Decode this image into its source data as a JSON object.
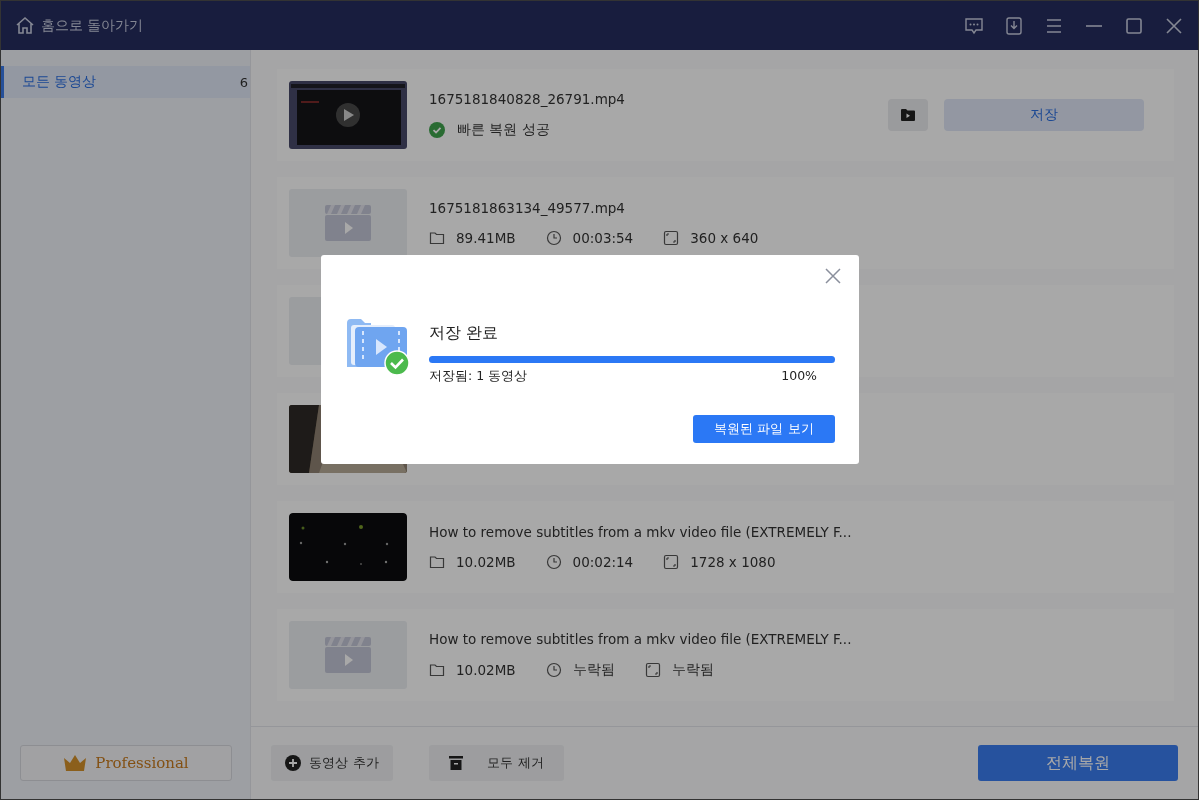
{
  "title_bar": {
    "back_label": "홈으로 돌아가기"
  },
  "sidebar": {
    "items": [
      {
        "label": "모든 동영상",
        "count": "6",
        "selected": true
      }
    ],
    "upgrade_label": "Professional"
  },
  "videos": [
    {
      "thumbnail": {
        "kind": "picture"
      },
      "name": "1675181840828_26791.mp4",
      "status": {
        "kind": "success",
        "text": "빠른 복원 성공"
      },
      "save_label": "저장"
    },
    {
      "thumbnail": {
        "kind": "placeholder"
      },
      "name": "1675181863134_49577.mp4",
      "meta": [
        {
          "kind": "size",
          "text": "89.41MB"
        },
        {
          "kind": "duration",
          "text": "00:03:54"
        },
        {
          "kind": "resolution",
          "text": "360 x 640"
        }
      ]
    },
    {
      "thumbnail": {
        "kind": "placeholder"
      }
    },
    {
      "thumbnail": {
        "kind": "picture"
      }
    },
    {
      "thumbnail": {
        "kind": "picture"
      },
      "name": "How to remove subtitles from a mkv video file (EXTREMELY F...",
      "meta": [
        {
          "kind": "size",
          "text": "10.02MB"
        },
        {
          "kind": "duration",
          "text": "00:02:14"
        },
        {
          "kind": "resolution",
          "text": "1728 x 1080"
        }
      ]
    },
    {
      "thumbnail": {
        "kind": "placeholder"
      },
      "name": "How to remove subtitles from a mkv video file (EXTREMELY F...",
      "meta": [
        {
          "kind": "size",
          "text": "10.02MB"
        },
        {
          "kind": "duration",
          "text": "누락됨"
        },
        {
          "kind": "resolution",
          "text": "누락됨"
        }
      ]
    }
  ],
  "footer": {
    "add_label": "동영상 추가",
    "remove_label": "모두 제거",
    "recover_all_label": "전체복원"
  },
  "dialog": {
    "title": "저장 완료",
    "progress": {
      "level": 1
    },
    "saved_text": "저장됨: 1 동영상",
    "percent": "100%",
    "button_label": "복원된 파일 보기"
  }
}
